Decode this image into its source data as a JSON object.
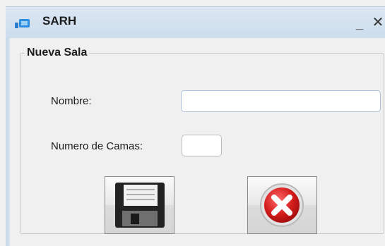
{
  "window": {
    "title": "SARH",
    "app_icon": "window-app-icon",
    "minimize_icon": "minimize-icon",
    "close_icon": "close-icon",
    "minimize_glyph": "_",
    "close_glyph": "✕"
  },
  "form": {
    "group_title": "Nueva Sala",
    "nombre_label": "Nombre:",
    "nombre_value": "",
    "camas_label": "Numero de Camas:",
    "camas_value": ""
  },
  "buttons": {
    "save_icon": "floppy-disk-save-icon",
    "cancel_icon": "red-x-cancel-icon"
  },
  "colors": {
    "titlebar": "#d3e2f1",
    "field_border": "#adc2d8",
    "cancel_red": "#d01818"
  }
}
